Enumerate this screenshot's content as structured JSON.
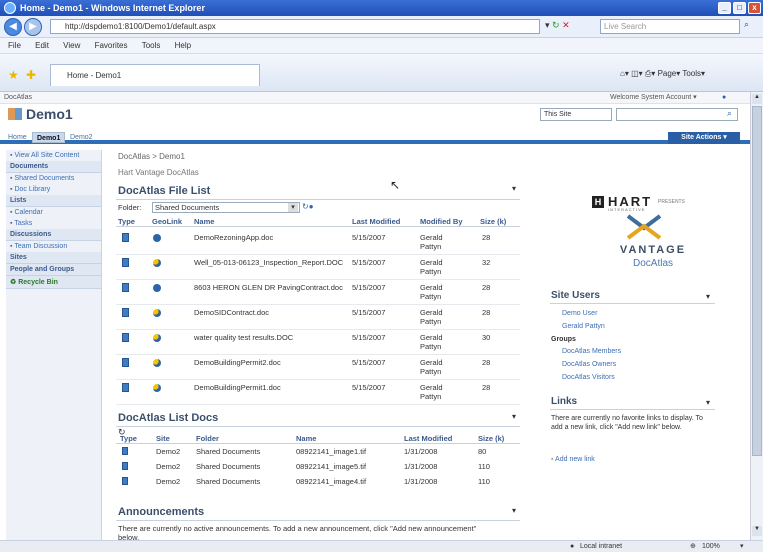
{
  "window": {
    "title": "Home - Demo1 - Windows Internet Explorer",
    "url": "http://dspdemo1:8100/Demo1/default.aspx",
    "search_placeholder": "Live Search",
    "tab": "Home - Demo1"
  },
  "menu": [
    "File",
    "Edit",
    "View",
    "Favorites",
    "Tools",
    "Help"
  ],
  "toolbar": {
    "page": "Page",
    "tools": "Tools"
  },
  "site": {
    "top_left": "DocAtlas",
    "welcome": "Welcome System Account ▾",
    "title": "Demo1",
    "scope": "This Site",
    "site_actions": "Site Actions ▾"
  },
  "tabs": [
    "Home",
    "Demo1",
    "Demo2"
  ],
  "leftnav": {
    "view_all": "View All Site Content",
    "documents": "Documents",
    "shared_docs": "Shared Documents",
    "doc_library": "Doc Library",
    "lists": "Lists",
    "calendar": "Calendar",
    "tasks": "Tasks",
    "discussions": "Discussions",
    "team_discussion": "Team Discussion",
    "sites": "Sites",
    "people": "People and Groups",
    "recycle": "Recycle Bin"
  },
  "breadcrumb": "DocAtlas > Demo1",
  "subtitle": "Hart Vantage DocAtlas",
  "filelist": {
    "title": "DocAtlas File List",
    "folder_label": "Folder:",
    "folder_value": "Shared Documents",
    "headers": [
      "Type",
      "GeoLink",
      "Name",
      "Last Modified",
      "Modified By",
      "Size (k)"
    ],
    "rows": [
      {
        "name": "DemoRezoningApp.doc",
        "date": "5/15/2007",
        "by": "Gerald Pattyn",
        "size": "28",
        "geo": "b"
      },
      {
        "name": "Well_05-013-06123_Inspection_Report.DOC",
        "date": "5/15/2007",
        "by": "Gerald Pattyn",
        "size": "32",
        "geo": "y"
      },
      {
        "name": "8603 HERON GLEN DR PavingContract.doc",
        "date": "5/15/2007",
        "by": "Gerald Pattyn",
        "size": "28",
        "geo": "b"
      },
      {
        "name": "DemoSIDContract.doc",
        "date": "5/15/2007",
        "by": "Gerald Pattyn",
        "size": "28",
        "geo": "y"
      },
      {
        "name": "water quality test results.DOC",
        "date": "5/15/2007",
        "by": "Gerald Pattyn",
        "size": "30",
        "geo": "y"
      },
      {
        "name": "DemoBuildingPermit2.doc",
        "date": "5/15/2007",
        "by": "Gerald Pattyn",
        "size": "28",
        "geo": "y"
      },
      {
        "name": "DemoBuildingPermit1.doc",
        "date": "5/15/2007",
        "by": "Gerald Pattyn",
        "size": "28",
        "geo": "y"
      }
    ]
  },
  "listdocs": {
    "title": "DocAtlas List Docs",
    "headers": [
      "Type",
      "Site",
      "Folder",
      "Name",
      "Last Modified",
      "Size (k)"
    ],
    "rows": [
      {
        "site": "Demo2",
        "folder": "Shared Documents",
        "name": "08922141_image1.tif",
        "date": "1/31/2008",
        "size": "80"
      },
      {
        "site": "Demo2",
        "folder": "Shared Documents",
        "name": "08922141_image5.tif",
        "date": "1/31/2008",
        "size": "110"
      },
      {
        "site": "Demo2",
        "folder": "Shared Documents",
        "name": "08922141_image4.tif",
        "date": "1/31/2008",
        "size": "110"
      }
    ]
  },
  "announcements": {
    "title": "Announcements",
    "text": "There are currently no active announcements. To add a new announcement, click \"Add new announcement\" below."
  },
  "logo": {
    "hart": "HART",
    "presents": "PRESENTS",
    "sub": "INTERACTIVE",
    "vantage": "VANTAGE",
    "docatlas": "DocAtlas"
  },
  "siteusers": {
    "title": "Site Users",
    "users": [
      "Demo User",
      "Gerald Pattyn"
    ],
    "groups_label": "Groups",
    "groups": [
      "DocAtlas Members",
      "DocAtlas Owners",
      "DocAtlas Visitors"
    ]
  },
  "links": {
    "title": "Links",
    "text": "There are currently no favorite links to display. To add a new link, click \"Add new link\" below.",
    "add": "Add new link"
  },
  "status": {
    "zone": "Local intranet",
    "zoom": "100%"
  }
}
